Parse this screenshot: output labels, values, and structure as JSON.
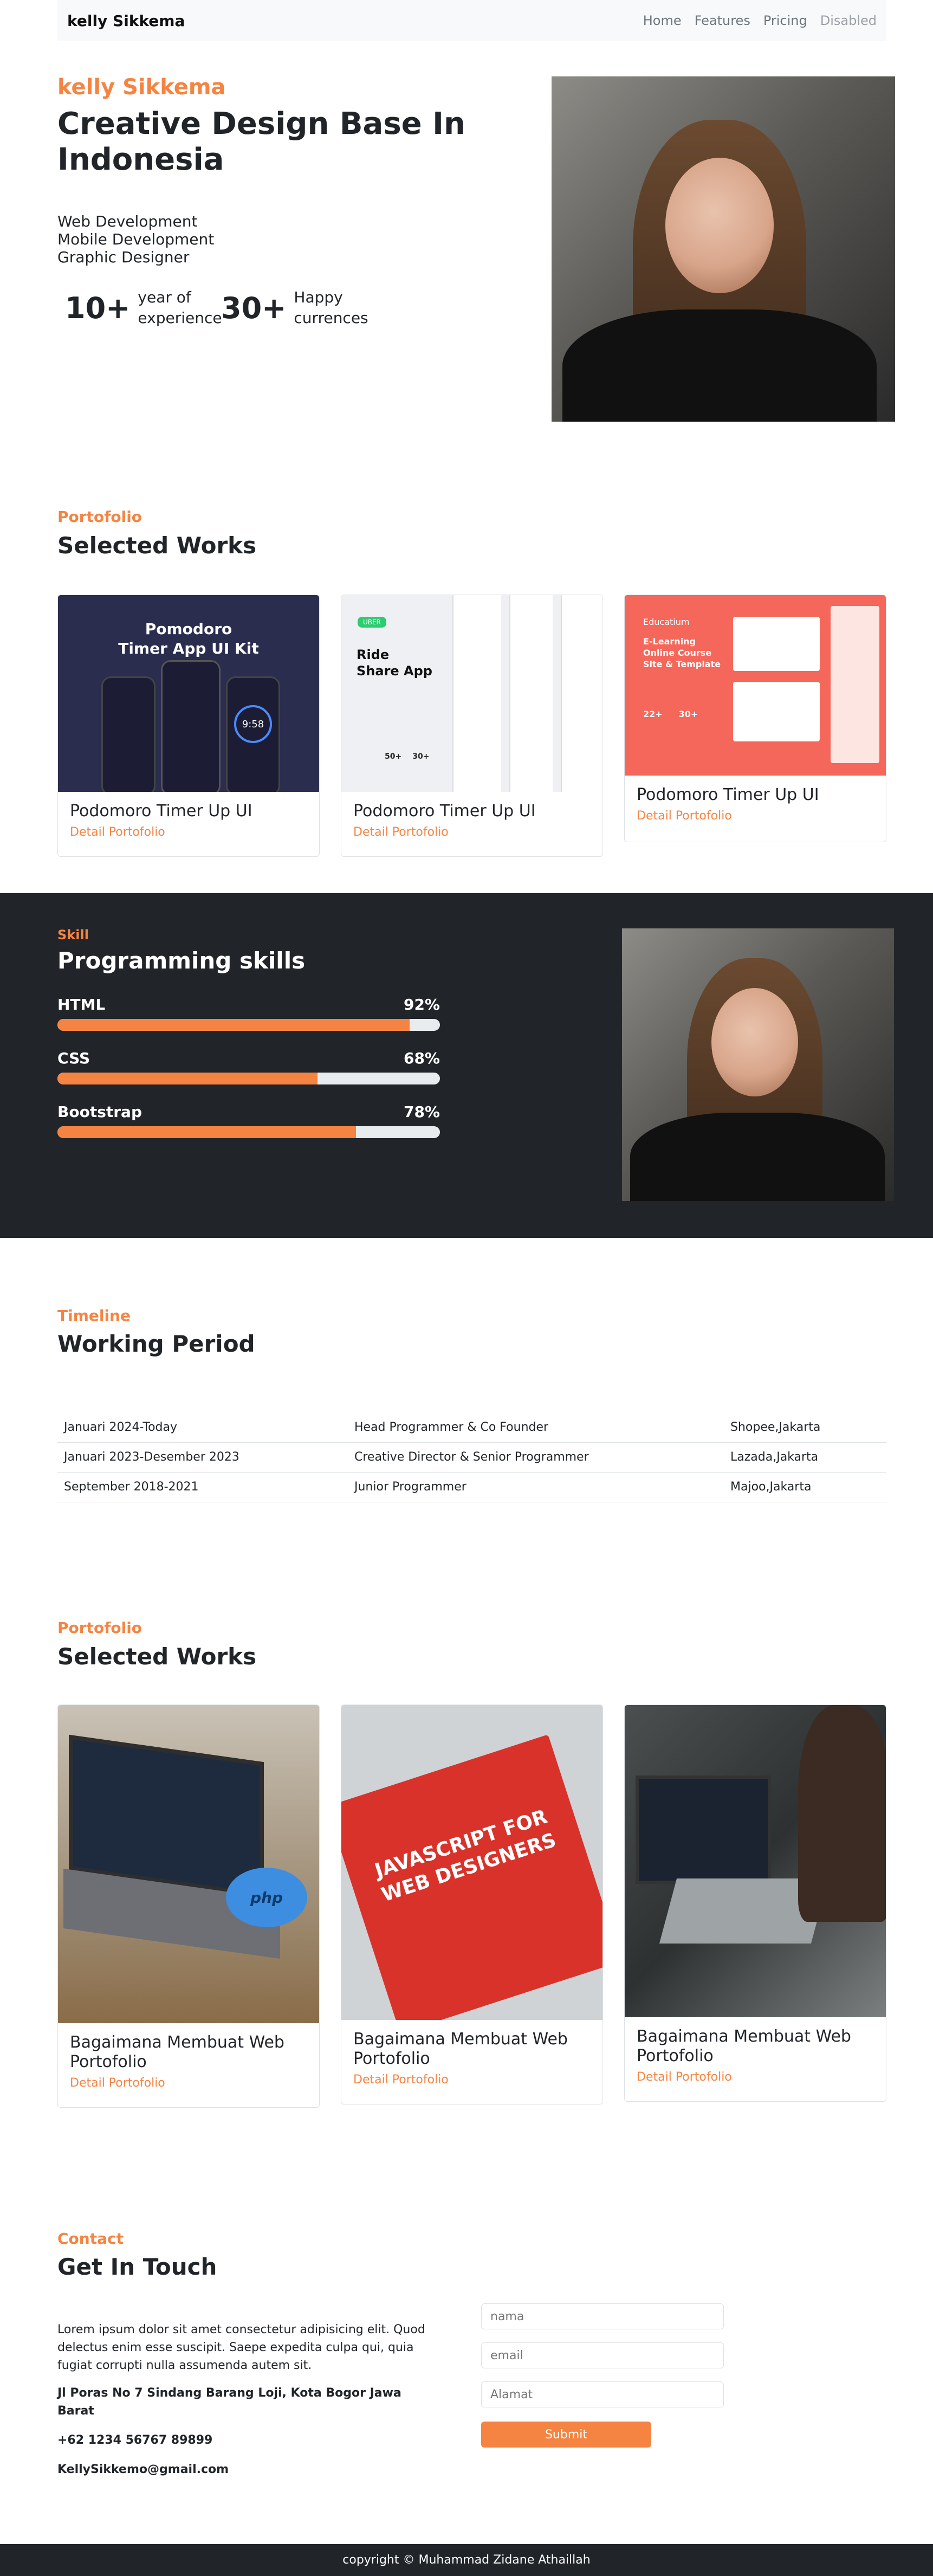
{
  "nav": {
    "brand": "kelly Sikkema",
    "items": [
      "Home",
      "Features",
      "Pricing",
      "Disabled"
    ]
  },
  "hero": {
    "name": "kelly Sikkema",
    "title": "Creative Design Base In Indonesia",
    "roles": [
      "Web Development",
      "Mobile Development",
      "Graphic Designer"
    ],
    "stats": [
      {
        "num": "10+",
        "label_1": "year of",
        "label_2": "experience"
      },
      {
        "num": "30+",
        "label_1": "Happy",
        "label_2": "currences"
      }
    ]
  },
  "portfolio1": {
    "label": "Portofolio",
    "title": "Selected Works",
    "cards": [
      {
        "title": "Podomoro Timer Up UI",
        "link": "Detail Portofolio",
        "thumb_text_1": "Pomodoro",
        "thumb_text_2": "Timer App UI  Kit",
        "thumb_time": "9:58"
      },
      {
        "title": "Podomoro Timer Up UI",
        "link": "Detail Portofolio",
        "thumb_badge": "UBER",
        "thumb_text_1": "Ride",
        "thumb_text_2": "Share App",
        "thumb_stat_1": "50+",
        "thumb_stat_2": "30+"
      },
      {
        "title": "Podomoro Timer Up UI",
        "link": "Detail Portofolio",
        "thumb_brand": "Educatium",
        "thumb_text_1": "E-Learning",
        "thumb_text_2": "Online Course",
        "thumb_text_3": "Site & Template",
        "thumb_stat_1": "22+",
        "thumb_stat_2": "30+"
      }
    ]
  },
  "skills": {
    "label": "Skill",
    "title": "Programming skills",
    "items": [
      {
        "name": "HTML",
        "percent_label": "92%",
        "level": 92
      },
      {
        "name": "CSS",
        "percent_label": "68%",
        "level": 68
      },
      {
        "name": "Bootstrap",
        "percent_label": "78%",
        "level": 78
      }
    ]
  },
  "timeline": {
    "label": "Timeline",
    "title": "Working Period",
    "rows": [
      [
        "Januari 2024-Today",
        "Head Programmer & Co Founder",
        "Shopee,Jakarta"
      ],
      [
        "Januari 2023-Desember 2023",
        "Creative Director & Senior Programmer",
        "Lazada,Jakarta"
      ],
      [
        "September 2018-2021",
        "Junior Programmer",
        "Majoo,Jakarta"
      ]
    ]
  },
  "portfolio2": {
    "label": "Portofolio",
    "title": "Selected Works",
    "cards": [
      {
        "title": "Bagaimana Membuat Web Portofolio",
        "link": "Detail Portofolio",
        "thumb_text": "php"
      },
      {
        "title": "Bagaimana Membuat Web Portofolio",
        "link": "Detail Portofolio",
        "thumb_text_1": "JAVASCRIPT FOR",
        "thumb_text_2": "WEB DESIGNERS"
      },
      {
        "title": "Bagaimana Membuat Web Portofolio",
        "link": "Detail Portofolio"
      }
    ]
  },
  "contact": {
    "label": "Contact",
    "title": "Get In Touch",
    "text": "Lorem ipsum dolor sit amet consectetur adipisicing elit. Quod delectus enim esse suscipit. Saepe expedita culpa qui, quia fugiat corrupti nulla assumenda autem sit.",
    "address": "Jl Poras No 7 Sindang Barang Loji, Kota Bogor Jawa Barat",
    "phone": "+62 1234 56767 89899",
    "email": "KellySikkemo@gmail.com",
    "form": {
      "name_placeholder": "nama",
      "email_placeholder": "email",
      "address_placeholder": "Alamat",
      "submit": "Submit"
    }
  },
  "footer": {
    "text": "copyright © Muhammad Zidane Athaillah"
  },
  "colors": {
    "accent": "#f58442",
    "dark": "#212529"
  }
}
